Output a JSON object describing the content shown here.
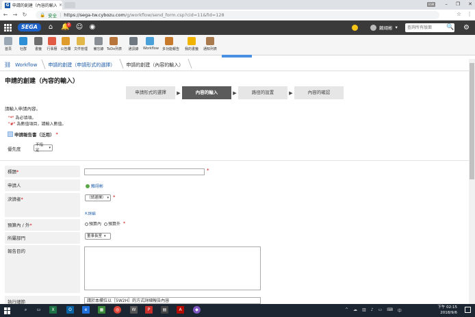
{
  "browser": {
    "tab_title": "申請的創建（內容的輸入）",
    "tab_close": "×",
    "secure_label": "安全",
    "url_host": "https://sega-tw.cybozu.com",
    "url_path": "/g/workflow/send_form.csp?cid=11&fid=128",
    "window_user": "ESM"
  },
  "header": {
    "logo": "SEGA",
    "notification_count": "2",
    "user_name": "賴翊彬",
    "search_placeholder": "查詢所有版面"
  },
  "apps": [
    {
      "label": "首頁",
      "color": "#9aa7b5"
    },
    {
      "label": "社群",
      "color": "#2f8fd6"
    },
    {
      "label": "書籤",
      "color": "#6e6e6e"
    },
    {
      "label": "行事曆",
      "color": "#e25b45"
    },
    {
      "label": "公告欄",
      "color": "#e09b2d"
    },
    {
      "label": "文件管理",
      "color": "#e3b84a"
    },
    {
      "label": "備忘錄",
      "color": "#8a8f96"
    },
    {
      "label": "ToDo列表",
      "color": "#b7753c"
    },
    {
      "label": "通訊錄",
      "color": "#6f7780"
    },
    {
      "label": "Workflow",
      "color": "#4aa0d9"
    },
    {
      "label": "多功能報告",
      "color": "#c77a2c"
    },
    {
      "label": "我的書籤",
      "color": "#f0b400"
    },
    {
      "label": "通知列表",
      "color": "#a87a4e"
    }
  ],
  "breadcrumb": [
    {
      "label": "Workflow"
    },
    {
      "label": "申請的創建（申請形式的選擇）"
    },
    {
      "label": "申請的創建（內容的輸入）"
    }
  ],
  "page_title": "申請的創建（內容的輸入）",
  "steps": [
    {
      "label": "申請形式的選擇"
    },
    {
      "label": "內容的輸入"
    },
    {
      "label": "路徑的設置"
    },
    {
      "label": "內容的確認"
    }
  ],
  "step_arrow": "▶",
  "instruction": "請輸入申請內容。",
  "notes": [
    {
      "mark": "\"*\"",
      "text": "為必填項。"
    },
    {
      "mark": "\"#\"",
      "text": "為數值項目，請輸入數值。"
    }
  ],
  "form_name": "申請報告書（泛用）",
  "form_name_mark": "*",
  "priority": {
    "label": "優先度",
    "value": "不指定"
  },
  "fields": {
    "title_label": "標題",
    "applicant_label": "申請人",
    "applicant_value": "賴翊彬",
    "approver_label": "決請者",
    "approver_value": "（請選擇）",
    "detail_link": "詳細",
    "budget_label": "預算內 / 外",
    "budget_in": "預算內",
    "budget_out": "預算外",
    "dept_label": "所屬部門",
    "dept_value": "董事長室",
    "purpose_label": "報告目的",
    "detail_label": "執行細節",
    "detail_value": "請於本欄位以［5W2H］的方式詳細報告內容"
  },
  "taskbar": {
    "time": "下午 02:15",
    "date": "2018/9/6"
  }
}
